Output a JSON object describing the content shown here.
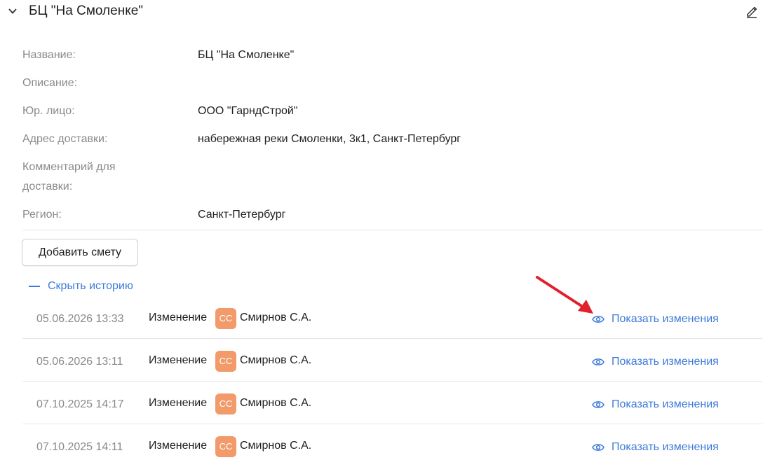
{
  "header": {
    "title": "БЦ \"На Смоленке\"",
    "collapse_icon": "chevron-down-icon",
    "edit_icon": "pencil-icon"
  },
  "fields": [
    {
      "label": "Название:",
      "value": "БЦ \"На Смоленке\""
    },
    {
      "label": "Описание:",
      "value": ""
    },
    {
      "label": "Юр. лицо:",
      "value": "ООО \"ГарндСтрой\""
    },
    {
      "label": "Адрес доставки:",
      "value": "набережная реки Смоленки, 3к1, Санкт-Петербург"
    },
    {
      "label": "Комментарий для",
      "label2": "доставки:",
      "value": ""
    },
    {
      "label": "Регион:",
      "value": "Санкт-Петербург"
    }
  ],
  "actions": {
    "add_estimate_label": "Добавить смету",
    "hide_history_label": "Скрыть историю"
  },
  "history": [
    {
      "date": "05.06.2026 13:33",
      "action": "Изменение",
      "avatar": "СС",
      "user": "Смирнов С.А.",
      "show_label": "Показать изменения"
    },
    {
      "date": "05.06.2026 13:11",
      "action": "Изменение",
      "avatar": "СС",
      "user": "Смирнов С.А.",
      "show_label": "Показать изменения"
    },
    {
      "date": "07.10.2025 14:17",
      "action": "Изменение",
      "avatar": "СС",
      "user": "Смирнов С.А.",
      "show_label": "Показать изменения"
    },
    {
      "date": "07.10.2025 14:11",
      "action": "Изменение",
      "avatar": "СС",
      "user": "Смирнов С.А.",
      "show_label": "Показать изменения"
    }
  ],
  "colors": {
    "accent": "#3d7bd9",
    "avatar_bg": "#f39a6b",
    "annotation_arrow": "#e0202e",
    "label_gray": "#8a8a8a"
  }
}
